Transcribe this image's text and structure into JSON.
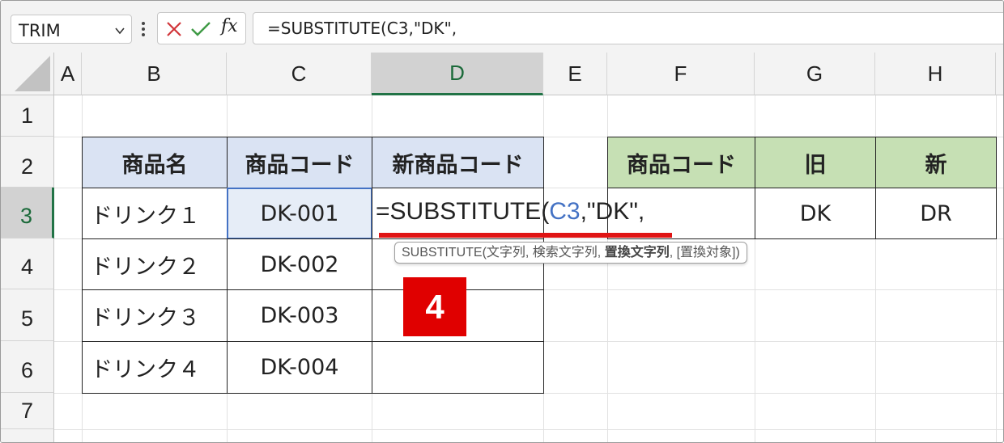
{
  "namebox": {
    "value": "TRIM"
  },
  "formula_bar": {
    "cancel_icon": "x-icon",
    "enter_icon": "check-icon",
    "fx_label": "fx",
    "text": "=SUBSTITUTE(C3,\"DK\","
  },
  "columns": [
    "A",
    "B",
    "C",
    "D",
    "E",
    "F",
    "G",
    "H"
  ],
  "rows": [
    "1",
    "2",
    "3",
    "4",
    "5",
    "6",
    "7"
  ],
  "selected": {
    "column": "D",
    "row": "3"
  },
  "table1": {
    "headers": [
      "商品名",
      "商品コード",
      "新商品コード"
    ],
    "rows": [
      [
        "ドリンク１",
        "DK-001",
        ""
      ],
      [
        "ドリンク２",
        "DK-002",
        ""
      ],
      [
        "ドリンク３",
        "DK-003",
        ""
      ],
      [
        "ドリンク４",
        "DK-004",
        ""
      ]
    ]
  },
  "table2": {
    "headers": [
      "商品コード",
      "旧",
      "新"
    ],
    "row": [
      "",
      "DK",
      "DR"
    ]
  },
  "editing": {
    "prefix": "=SUBSTITUTE(",
    "ref": "C3",
    "suffix": ",\"DK\","
  },
  "tooltip": {
    "pre": "SUBSTITUTE(文字列, 検索文字列, ",
    "bold": "置換文字列",
    "post": ", [置換対象])"
  },
  "step_badge": "4",
  "colors": {
    "header_blue": "#dae3f3",
    "header_green": "#c6e0b4",
    "accent_green": "#217346",
    "ref_blue": "#4472c4",
    "badge_red": "#e00000"
  }
}
